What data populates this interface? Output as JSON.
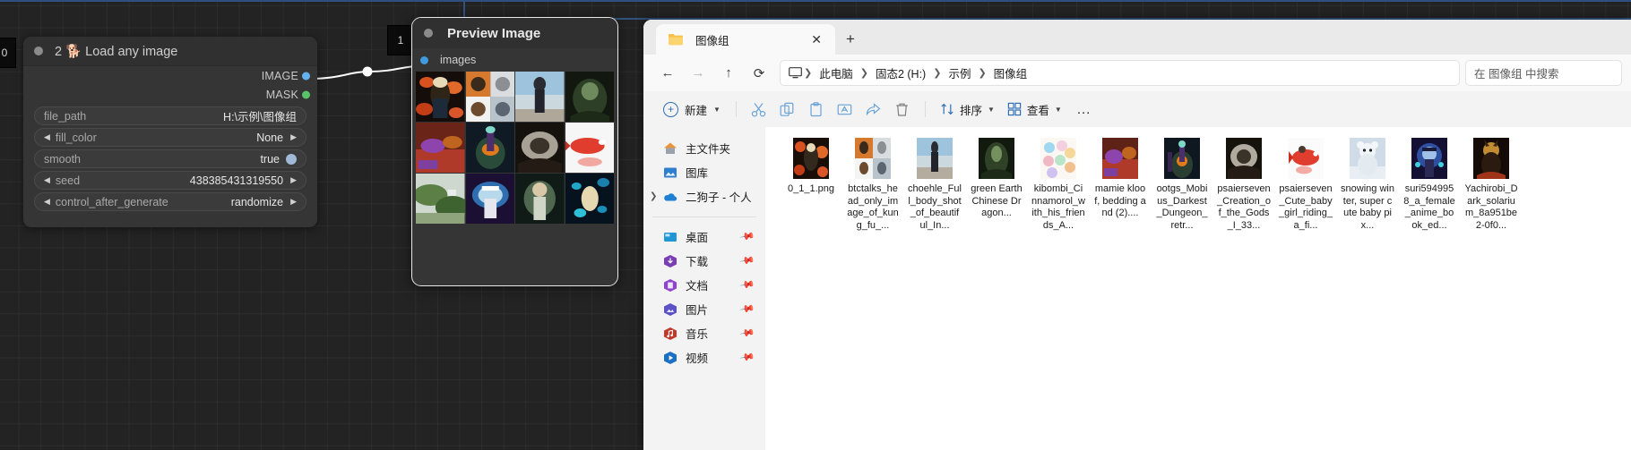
{
  "workflow": {
    "badges": {
      "node0": "0",
      "node1": "1"
    },
    "load_node": {
      "title": "2 🐕 Load any image",
      "outputs": [
        {
          "label": "IMAGE",
          "color": "#62b3f0"
        },
        {
          "label": "MASK",
          "color": "#57c46a"
        }
      ],
      "widgets": [
        {
          "name": "file_path",
          "value": "H:\\示例\\图像组",
          "type": "text"
        },
        {
          "name": "fill_color",
          "value": "None",
          "type": "combo"
        },
        {
          "name": "smooth",
          "value": "true",
          "type": "toggle"
        },
        {
          "name": "seed",
          "value": "438385431319550",
          "type": "number"
        },
        {
          "name": "control_after_generate",
          "value": "randomize",
          "type": "combo"
        }
      ]
    },
    "preview_node": {
      "title": "Preview Image",
      "input_label": "images",
      "thumbnails": 12
    }
  },
  "explorer": {
    "tab": {
      "title": "图像组",
      "close_label": "✕",
      "new_tab_label": "+"
    },
    "nav": {
      "back": "←",
      "forward": "→",
      "up": "↑",
      "refresh": "⟳",
      "breadcrumb": [
        "此电脑",
        "固态2 (H:)",
        "示例",
        "图像组"
      ],
      "search_placeholder": "在 图像组 中搜索"
    },
    "toolbar": {
      "new_label": "新建",
      "cut": "cut-icon",
      "copy": "copy-icon",
      "paste": "paste-icon",
      "rename": "rename-icon",
      "share": "share-icon",
      "delete": "delete-icon",
      "sort_label": "排序",
      "view_label": "查看",
      "more_label": "..."
    },
    "sidebar": {
      "group1": [
        {
          "label": "主文件夹",
          "icon": "home-icon",
          "color": "#e08a2e",
          "expander": false
        },
        {
          "label": "图库",
          "icon": "gallery-icon",
          "color": "#2f7fd0",
          "expander": false
        },
        {
          "label": "二狗子 - 个人",
          "icon": "onedrive-icon",
          "color": "#1e7fd4",
          "expander": true
        }
      ],
      "group2": [
        {
          "label": "桌面",
          "icon": "desktop-icon",
          "color": "#2196d6",
          "pinned": true
        },
        {
          "label": "下载",
          "icon": "downloads-icon",
          "color": "#7b3fb5",
          "pinned": true
        },
        {
          "label": "文档",
          "icon": "documents-icon",
          "color": "#8e44d0",
          "pinned": true
        },
        {
          "label": "图片",
          "icon": "pictures-icon",
          "color": "#5b51c9",
          "pinned": true
        },
        {
          "label": "音乐",
          "icon": "music-icon",
          "color": "#c0392b",
          "pinned": true
        },
        {
          "label": "视频",
          "icon": "videos-icon",
          "color": "#1b6fc4",
          "pinned": true
        }
      ]
    },
    "files": [
      {
        "name": "0_1_1.png",
        "thumb": "tiger-floral"
      },
      {
        "name": "btctalks_head_only_image_of_kung_fu_...",
        "thumb": "portraits-grid"
      },
      {
        "name": "choehle_Full_body_shot_of_beautiful_In...",
        "thumb": "beach-woman"
      },
      {
        "name": "green Earth Chinese Dragon...",
        "thumb": "green-dragon"
      },
      {
        "name": "kibombi_Cinnamorol_with_his_friends_A...",
        "thumb": "kawaii-cats"
      },
      {
        "name": "mamie kloof, bedding and (2)....",
        "thumb": "bedroom"
      },
      {
        "name": "ootgs_Mobius_Darkest_Dungeon_retr...",
        "thumb": "dark-dungeon"
      },
      {
        "name": "psaierseven_Creation_of_the_Gods_I_33...",
        "thumb": "creation-gods"
      },
      {
        "name": "psaierseven_Cute_baby_girl_riding_a_fi...",
        "thumb": "red-fish"
      },
      {
        "name": "snowing winter, super cute baby pix...",
        "thumb": "white-bear"
      },
      {
        "name": "suri5949958_a_female_anime_book_ed...",
        "thumb": "anime-female"
      },
      {
        "name": "Yachirobi_Dark_solarium_8a951be2-0f0...",
        "thumb": "dark-solarium"
      }
    ]
  }
}
